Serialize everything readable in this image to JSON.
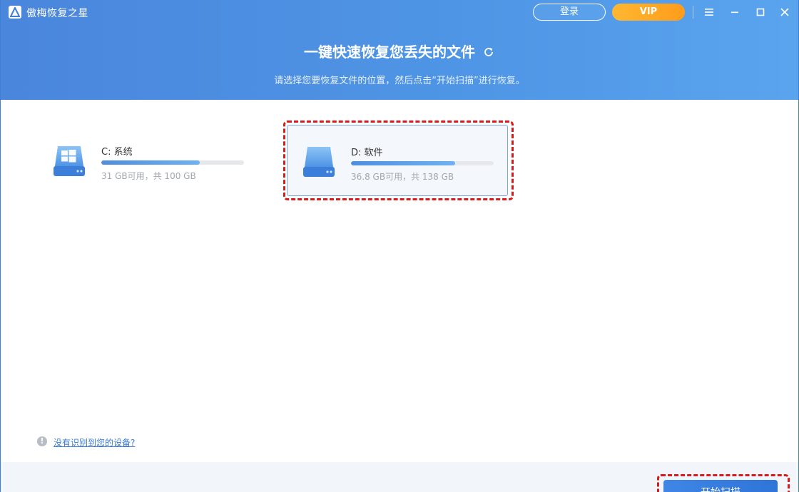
{
  "app": {
    "title": "傲梅恢复之星"
  },
  "titlebar": {
    "login_label": "登录",
    "vip_label": "VIP"
  },
  "hero": {
    "headline": "一键快速恢复您丢失的文件",
    "subline": "请选择您要恢复文件的位置，然后点击“开始扫描”进行恢复。"
  },
  "drives": [
    {
      "name": "C: 系统",
      "usage": "31 GB可用，共 100 GB",
      "used_fraction": 0.69,
      "icon": "windows-drive-icon",
      "selected": false
    },
    {
      "name": "D: 软件",
      "usage": "36.8 GB可用，共 138 GB",
      "used_fraction": 0.73,
      "icon": "drive-icon",
      "selected": true
    }
  ],
  "help": {
    "link_label": "没有识别到您的设备?"
  },
  "footer": {
    "scan_label": "开始扫描"
  },
  "colors": {
    "accent": "#4a86dc",
    "vip": "#ff9c1a",
    "highlight": "#d81a1a"
  }
}
